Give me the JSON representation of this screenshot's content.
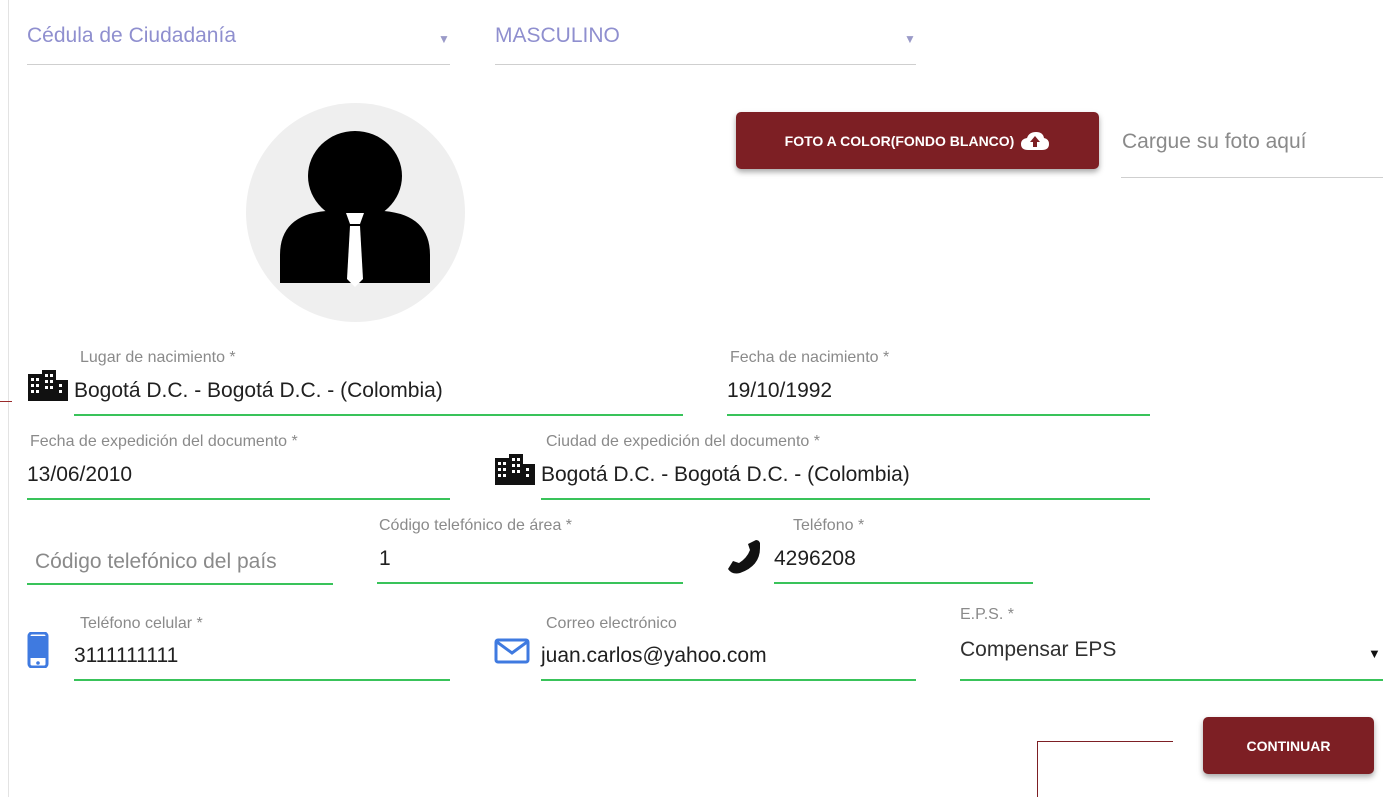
{
  "colors": {
    "accent": "#7d1f24",
    "underline_active": "#39c35a",
    "select_text": "#8f8fcf",
    "icon_blue": "#3f7ae0"
  },
  "document_type": {
    "value": "Cédula de Ciudadanía",
    "icon": "triangle-down-icon"
  },
  "gender": {
    "value": "MASCULINO",
    "icon": "triangle-down-icon"
  },
  "photo": {
    "avatar_icon": "person-with-tie-icon",
    "upload_button_label": "FOTO A COLOR(FONDO BLANCO)",
    "upload_icon": "cloud-upload-icon",
    "upload_placeholder": "Cargue su foto aquí"
  },
  "birth_place": {
    "label": "Lugar de nacimiento *",
    "value": "Bogotá D.C. - Bogotá D.C. - (Colombia)",
    "icon": "city-icon"
  },
  "birth_date": {
    "label": "Fecha de nacimiento *",
    "value": "19/10/1992"
  },
  "issue_date": {
    "label": "Fecha de expedición del documento *",
    "value": "13/06/2010"
  },
  "issue_city": {
    "label": "Ciudad de expedición del documento *",
    "value": "Bogotá D.C. - Bogotá D.C. - (Colombia)",
    "icon": "city-icon"
  },
  "country_code": {
    "placeholder": "Código telefónico del país"
  },
  "area_code": {
    "label": "Código telefónico de área *",
    "value": "1"
  },
  "phone": {
    "label": "Teléfono *",
    "value": "4296208",
    "icon": "phone-icon"
  },
  "mobile": {
    "label": "Teléfono celular *",
    "value": "3111111111",
    "icon": "mobile-phone-icon"
  },
  "email": {
    "label": "Correo electrónico",
    "value": "juan.carlos@yahoo.com",
    "icon": "envelope-icon"
  },
  "eps": {
    "label": "E.P.S. *",
    "value": "Compensar EPS",
    "icon": "triangle-down-icon"
  },
  "continue_button": {
    "label": "CONTINUAR"
  }
}
